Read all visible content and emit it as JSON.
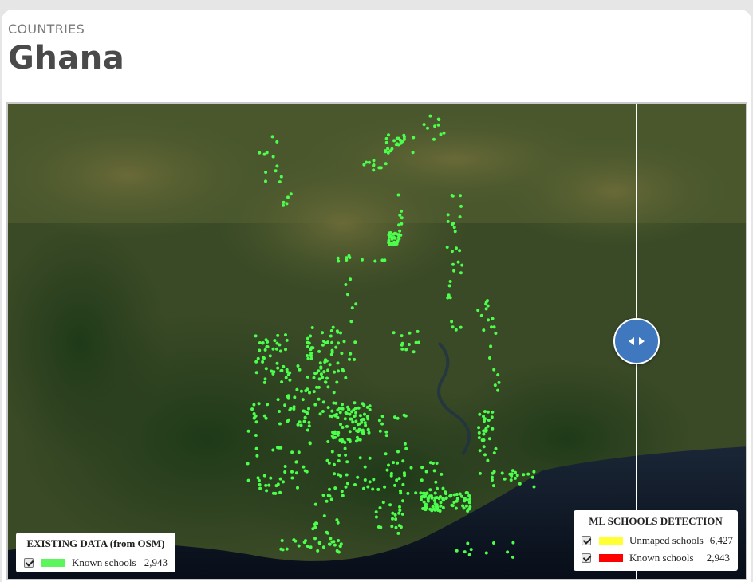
{
  "header": {
    "eyebrow": "COUNTRIES",
    "title": "Ghana"
  },
  "map": {
    "point_color": "#4dff4d",
    "water_color": "#0b1322"
  },
  "legend_existing": {
    "title": "EXISTING DATA (from OSM)",
    "items": [
      {
        "label": "Known schools",
        "count": "2,943",
        "color": "#5cf55c",
        "checked": true
      }
    ]
  },
  "legend_ml": {
    "title": "ML SCHOOLS DETECTION",
    "items": [
      {
        "label": "Unmaped schools",
        "count": "6,427",
        "color": "#ffff33",
        "checked": true
      },
      {
        "label": "Known schools",
        "count": "2,943",
        "color": "#ff0000",
        "checked": true
      }
    ]
  },
  "slider": {
    "icon": "left-right-arrows-icon"
  }
}
